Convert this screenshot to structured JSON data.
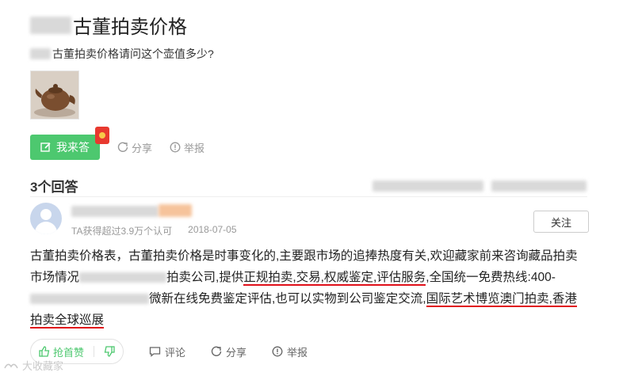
{
  "question": {
    "title": "古董拍卖价格",
    "description": "古董拍卖价格请问这个壶值多少?"
  },
  "actions": {
    "answer_label": "我来答",
    "share_label": "分享",
    "report_label": "举报"
  },
  "answers_header": {
    "count_label": "3个回答"
  },
  "answer": {
    "author_meta": "TA获得超过3.9万个认可",
    "date": "2018-07-05",
    "follow_label": "关注",
    "text_part1": "古董拍卖价格表，古董拍卖价格是时事变化的,主要跟市场的追捧热度有关,欢迎藏家前来咨询藏品拍卖市场情况",
    "text_part2": "拍卖公司,提供",
    "text_hl1": "正规拍卖,交易,权威鉴定,评估服务",
    "text_part3": ",全国统一免费热线:400-",
    "text_part4": "微新在线免费鉴定评估,也可以实物到公司鉴定交流,",
    "text_hl2": "国际艺术博览澳门拍卖,香港拍卖全球巡展",
    "like_label": "抢首赞",
    "comment_label": "评论",
    "share_label": "分享",
    "report_label": "举报"
  },
  "watermark": "大收藏家",
  "colors": {
    "accent_green": "#4dc86f",
    "highlight_red": "#e0101a"
  }
}
